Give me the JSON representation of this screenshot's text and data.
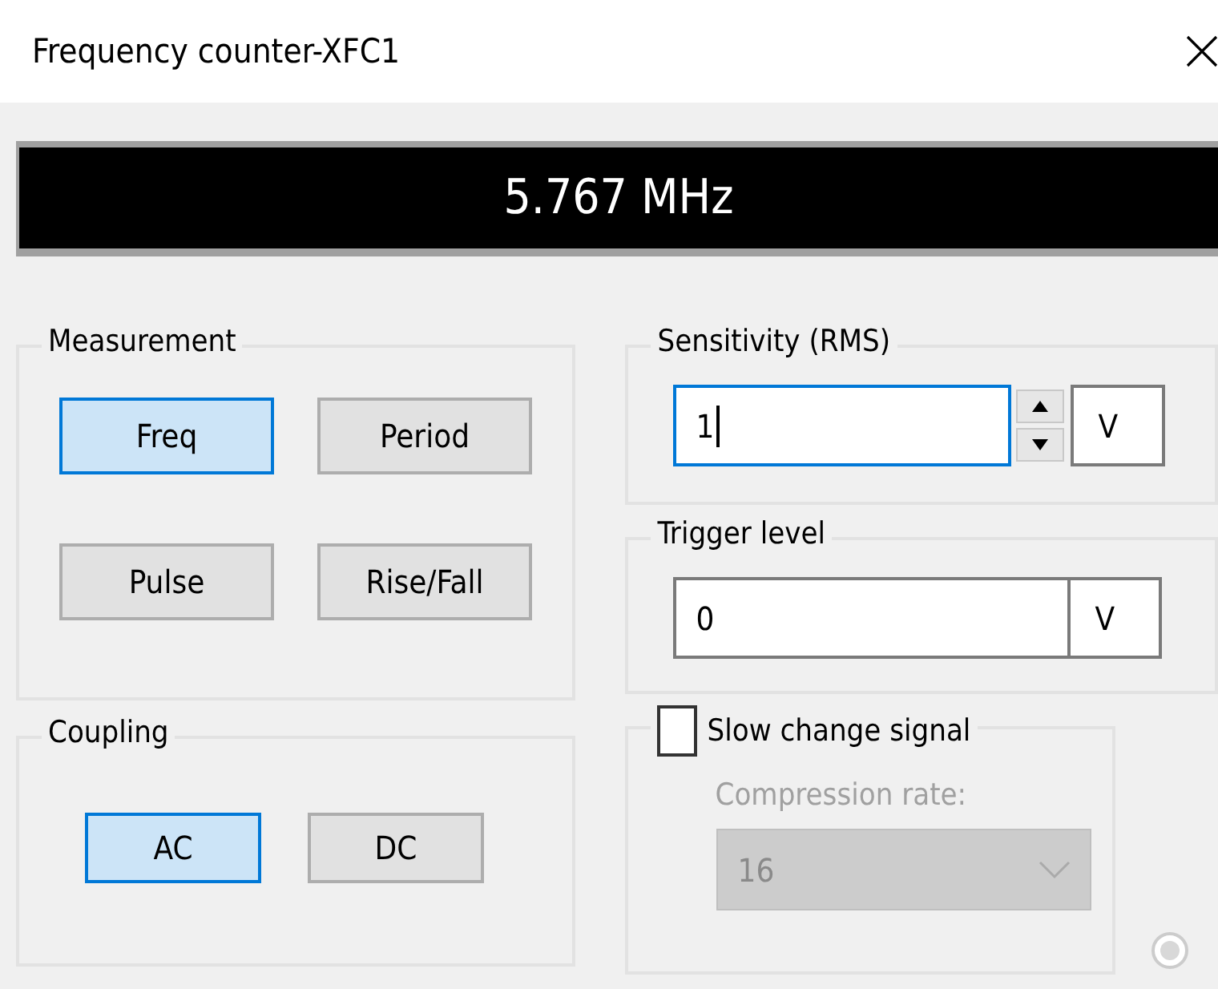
{
  "window": {
    "title": "Frequency counter-XFC1"
  },
  "display": {
    "reading": "5.767 MHz"
  },
  "measurement": {
    "title": "Measurement",
    "buttons": [
      {
        "label": "Freq",
        "selected": true
      },
      {
        "label": "Period",
        "selected": false
      },
      {
        "label": "Pulse",
        "selected": false
      },
      {
        "label": "Rise/Fall",
        "selected": false
      }
    ]
  },
  "coupling": {
    "title": "Coupling",
    "buttons": [
      {
        "label": "AC",
        "selected": true
      },
      {
        "label": "DC",
        "selected": false
      }
    ]
  },
  "sensitivity": {
    "title": "Sensitivity (RMS)",
    "value": "1",
    "unit": "V",
    "focused": true
  },
  "trigger": {
    "title": "Trigger level",
    "value": "0",
    "unit": "V",
    "focused": false
  },
  "slow_change": {
    "label": "Slow change signal",
    "checked": false,
    "compression_label": "Compression rate:",
    "compression_value": "16",
    "disabled": true
  }
}
